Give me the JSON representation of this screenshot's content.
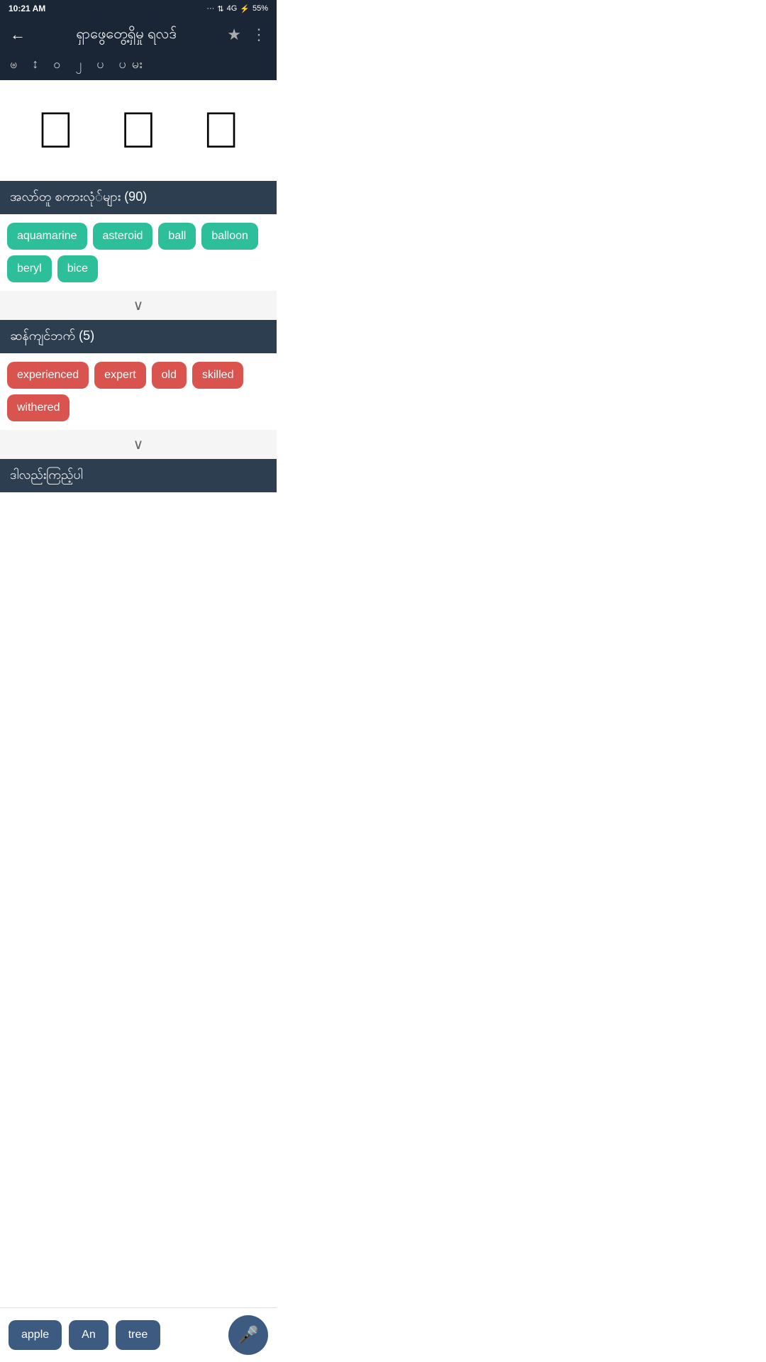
{
  "statusBar": {
    "time": "10:21 AM",
    "signal": "4G",
    "battery": "55%"
  },
  "header": {
    "title": "ရှာဖွေတွေ့ရှိမှု ရလဒ်",
    "backLabel": "←",
    "starIcon": "★",
    "dotsIcon": "⋮",
    "subtext": "ၑ  ↕  ၀ ၂ ပ          ပမး"
  },
  "imagesRow": {
    "icon1": "",
    "icon2": "",
    "icon3": ""
  },
  "section1": {
    "title": "အလာ်တူ စကားလုံ်များ (90)",
    "tags": [
      "aquamarine",
      "asteroid",
      "ball",
      "balloon",
      "beryl",
      "bice"
    ],
    "expandLabel": "∨"
  },
  "section2": {
    "title": "ဆန်ကျင်ဘက် (5)",
    "tags": [
      "experienced",
      "expert",
      "old",
      "skilled",
      "withered"
    ],
    "expandLabel": "∨"
  },
  "section3": {
    "title": "ဒါလည်းကြည့်ပါ"
  },
  "bottomBar": {
    "tags": [
      "apple",
      "An",
      "tree"
    ],
    "micIcon": "🎤"
  }
}
